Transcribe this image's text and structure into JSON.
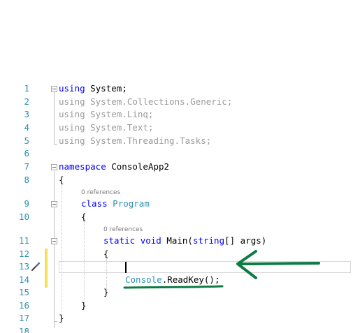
{
  "editor": {
    "line_numbers": [
      "1",
      "2",
      "3",
      "4",
      "5",
      "6",
      "7",
      "8",
      "9",
      "10",
      "11",
      "12",
      "13",
      "14",
      "15",
      "16",
      "17",
      "18"
    ],
    "references_label": "0 references",
    "lines": {
      "l1": {
        "kw": "using",
        "rest": " System;"
      },
      "l2": {
        "text": "using System.Collections.Generic;"
      },
      "l3": {
        "text": "using System.Linq;"
      },
      "l4": {
        "text": "using System.Text;"
      },
      "l5": {
        "text": "using System.Threading.Tasks;"
      },
      "l7": {
        "kw": "namespace",
        "rest": " ConsoleApp2"
      },
      "l8": {
        "text": "{"
      },
      "l9": {
        "kw": "class",
        "space": " ",
        "type": "Program"
      },
      "l10": {
        "text": "{"
      },
      "l11": {
        "kw1": "static",
        "sp1": " ",
        "kw2": "void",
        "mid": " Main(",
        "kw3": "string",
        "rest": "[] args)"
      },
      "l12": {
        "text": "{"
      },
      "l14": {
        "type": "Console",
        "rest": ".ReadKey();"
      },
      "l15": {
        "text": "}"
      },
      "l16": {
        "text": "}"
      },
      "l17": {
        "text": "}"
      }
    },
    "annotation_color": "#0f7a45",
    "change_bar_color": "#f5e05a"
  }
}
